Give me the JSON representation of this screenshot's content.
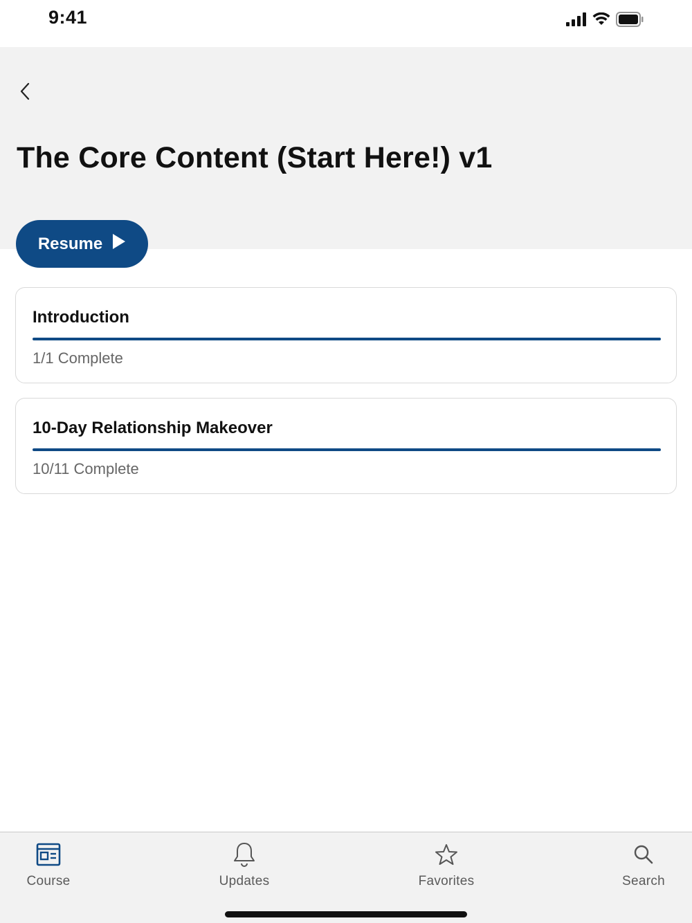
{
  "status_bar": {
    "time": "9:41",
    "icons": [
      "signal-icon",
      "wifi-icon",
      "battery-icon"
    ]
  },
  "header": {
    "back_icon": "chevron-left-icon",
    "title": "The Core Content (Start Here!) v1",
    "resume_label": "Resume",
    "resume_icon": "play-icon"
  },
  "sections": [
    {
      "title": "Introduction",
      "status": "1/1 Complete",
      "progress": 1.0
    },
    {
      "title": "10-Day Relationship Makeover",
      "status": "10/11 Complete",
      "progress": 1.0
    }
  ],
  "tab_bar": {
    "tabs": [
      {
        "label": "Course",
        "icon": "course-icon",
        "active": true
      },
      {
        "label": "Updates",
        "icon": "bell-icon",
        "active": false
      },
      {
        "label": "Favorites",
        "icon": "star-icon",
        "active": false
      },
      {
        "label": "Search",
        "icon": "search-icon",
        "active": false
      }
    ]
  },
  "colors": {
    "accent": "#0f4a85",
    "header_bg": "#f2f2f2",
    "text": "#111111",
    "muted_text": "#666666"
  }
}
